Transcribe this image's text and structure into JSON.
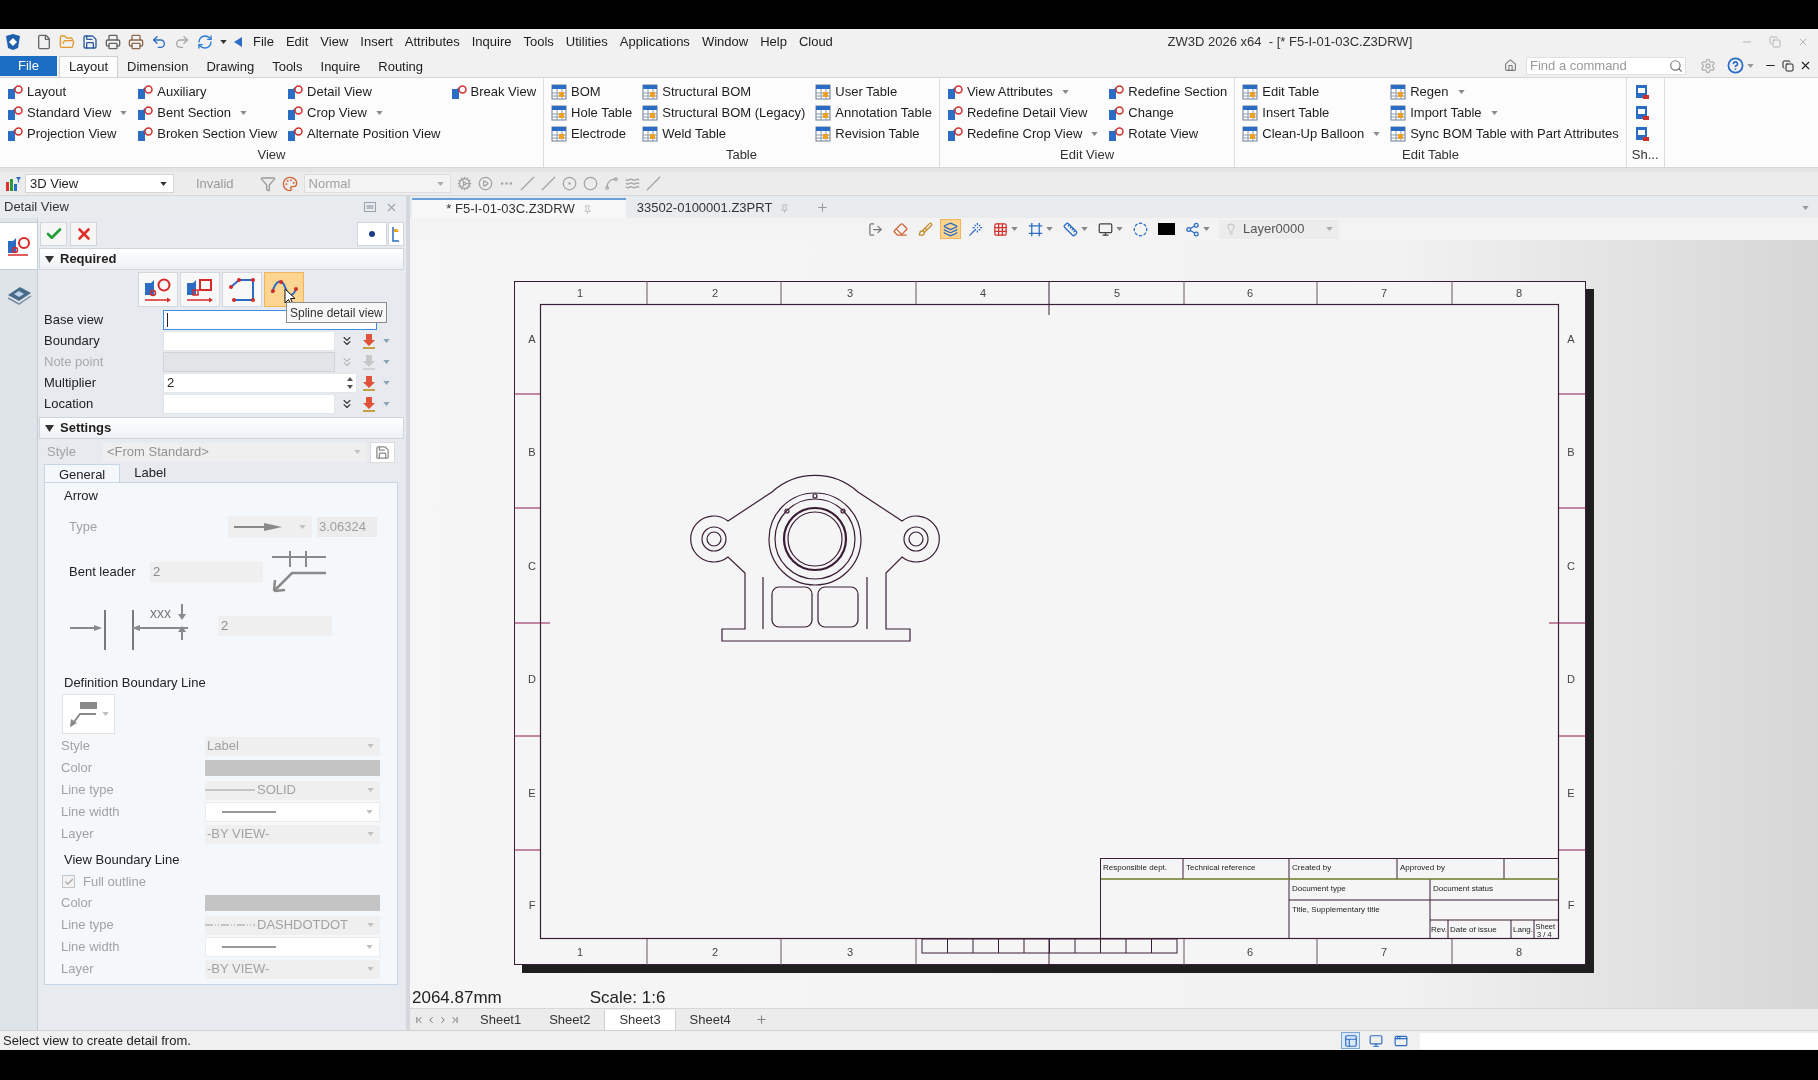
{
  "window": {
    "title": "ZW3D 2026 x64  - [* F5-I-01-03C.Z3DRW]"
  },
  "menu_bar": [
    "File",
    "Edit",
    "View",
    "Insert",
    "Attributes",
    "Inquire",
    "Tools",
    "Utilities",
    "Applications",
    "Window",
    "Help",
    "Cloud"
  ],
  "ribbon_tabs": [
    {
      "label": "File",
      "kind": "application",
      "selected": false
    },
    {
      "label": "Layout",
      "kind": "tab",
      "selected": true
    },
    {
      "label": "Dimension",
      "kind": "tab",
      "selected": false
    },
    {
      "label": "Drawing",
      "kind": "tab",
      "selected": false
    },
    {
      "label": "Tools",
      "kind": "tab",
      "selected": false
    },
    {
      "label": "Inquire",
      "kind": "tab",
      "selected": false
    },
    {
      "label": "Routing",
      "kind": "tab",
      "selected": false
    }
  ],
  "command_search": {
    "placeholder": "Find a command"
  },
  "ribbon_groups": [
    {
      "label": "View",
      "columns": [
        [
          {
            "label": "Layout",
            "dropdown": false
          },
          {
            "label": "Standard View",
            "dropdown": true
          },
          {
            "label": "Projection View",
            "dropdown": false
          }
        ],
        [
          {
            "label": "Auxiliary",
            "dropdown": false
          },
          {
            "label": "Bent Section",
            "dropdown": true
          },
          {
            "label": "Broken Section View",
            "dropdown": false
          }
        ],
        [
          {
            "label": "Detail View",
            "dropdown": false
          },
          {
            "label": "Crop View",
            "dropdown": true
          },
          {
            "label": "Alternate Position View",
            "dropdown": false
          }
        ],
        [
          {
            "label": "Break View",
            "dropdown": false
          }
        ]
      ]
    },
    {
      "label": "Table",
      "columns": [
        [
          {
            "label": "BOM",
            "dropdown": false
          },
          {
            "label": "Hole Table",
            "dropdown": false
          },
          {
            "label": "Electrode",
            "dropdown": false
          }
        ],
        [
          {
            "label": "Structural BOM",
            "dropdown": false
          },
          {
            "label": "Structural BOM (Legacy)",
            "dropdown": false
          },
          {
            "label": "Weld Table",
            "dropdown": false
          }
        ],
        [
          {
            "label": "User Table",
            "dropdown": false
          },
          {
            "label": "Annotation Table",
            "dropdown": false
          },
          {
            "label": "Revision Table",
            "dropdown": false
          }
        ]
      ]
    },
    {
      "label": "Edit View",
      "columns": [
        [
          {
            "label": "View Attributes",
            "dropdown": true
          },
          {
            "label": "Redefine Detail View",
            "dropdown": false
          },
          {
            "label": "Redefine Crop View",
            "dropdown": true
          }
        ],
        [
          {
            "label": "Redefine Section",
            "dropdown": false
          },
          {
            "label": "Change",
            "dropdown": false
          },
          {
            "label": "Rotate View",
            "dropdown": false
          }
        ]
      ]
    },
    {
      "label": "Edit Table",
      "columns": [
        [
          {
            "label": "Edit Table",
            "dropdown": false
          },
          {
            "label": "Insert Table",
            "dropdown": false
          },
          {
            "label": "Clean-Up Balloon",
            "dropdown": true
          }
        ],
        [
          {
            "label": "Regen",
            "dropdown": true
          },
          {
            "label": "Import Table",
            "dropdown": true
          },
          {
            "label": "Sync BOM Table with Part Attributes",
            "dropdown": false
          }
        ]
      ]
    },
    {
      "label": "Sh...",
      "columns": [
        [
          {
            "dropdown": false
          },
          {
            "dropdown": false
          },
          {
            "dropdown": false
          }
        ]
      ]
    }
  ],
  "view_toolbar": {
    "view": "3D View",
    "filter": {
      "label": "Invalid",
      "disabled": true
    },
    "mode": {
      "value": "Normal",
      "disabled": true
    }
  },
  "command_panel": {
    "title": "Detail View",
    "side_tabs": [
      {
        "selected": true
      },
      {
        "selected": false
      }
    ],
    "required": {
      "label": "Required",
      "expanded": true,
      "methods": [
        {
          "selected": false
        },
        {
          "selected": false
        },
        {
          "selected": false
        },
        {
          "selected": true
        }
      ],
      "tooltip": "Spline detail view",
      "fields": [
        {
          "label": "Base view",
          "kind": "entry",
          "focused": true,
          "disabled": false
        },
        {
          "label": "Boundary",
          "kind": "pick",
          "focused": false,
          "disabled": false
        },
        {
          "label": "Note point",
          "kind": "pick",
          "focused": false,
          "disabled": true
        },
        {
          "label": "Multiplier",
          "kind": "number",
          "value": "2",
          "focused": false,
          "disabled": false
        },
        {
          "label": "Location",
          "kind": "pick",
          "focused": false,
          "disabled": false
        }
      ]
    },
    "settings": {
      "label": "Settings",
      "expanded": true,
      "style": {
        "label": "Style",
        "value": "<From Standard>",
        "disabled": true
      },
      "tabs": [
        {
          "label": "General",
          "selected": true
        },
        {
          "label": "Label",
          "selected": false
        }
      ],
      "arrow": {
        "heading": "Arrow",
        "type": {
          "label": "Type",
          "value": "3.06324",
          "disabled": true
        },
        "bent_leader": {
          "label": "Bent leader",
          "value": "2"
        },
        "extension": {
          "sample": "xxx",
          "value": "2"
        }
      },
      "definition_boundary_line": {
        "heading": "Definition Boundary Line",
        "properties": [
          {
            "label": "Style",
            "kind": "select",
            "value": "Label",
            "disabled": true
          },
          {
            "label": "Color",
            "kind": "color",
            "disabled": true
          },
          {
            "label": "Line type",
            "kind": "line_type",
            "dashed": false,
            "value": "SOLID",
            "disabled": true
          },
          {
            "label": "Line width",
            "kind": "line_width",
            "disabled": true
          },
          {
            "label": "Layer",
            "kind": "select",
            "value": "-BY VIEW-",
            "disabled": true
          }
        ]
      },
      "view_boundary_line": {
        "heading": "View Boundary Line",
        "full_outline": {
          "label": "Full outline",
          "checked": true,
          "disabled": true
        },
        "properties": [
          {
            "label": "Color",
            "kind": "color",
            "disabled": true
          },
          {
            "label": "Line type",
            "kind": "line_type",
            "dashed": true,
            "value": "DASHDOTDOT",
            "disabled": true
          },
          {
            "label": "Line width",
            "kind": "line_width",
            "disabled": true
          },
          {
            "label": "Layer",
            "kind": "select",
            "value": "-BY VIEW-",
            "disabled": true
          }
        ]
      }
    }
  },
  "documents": [
    {
      "label": "* F5-I-01-03C.Z3DRW",
      "selected": true
    },
    {
      "label": "33502-0100001.Z3PRT",
      "selected": false
    }
  ],
  "drawing_toolbar": {
    "tools": [
      {
        "active": false,
        "dropdown": false
      },
      {
        "active": false,
        "dropdown": false
      },
      {
        "active": false,
        "dropdown": false
      },
      {
        "active": true,
        "dropdown": false
      },
      {
        "active": false,
        "dropdown": false
      },
      {
        "active": false,
        "dropdown": true
      },
      {
        "active": false,
        "dropdown": true
      },
      {
        "active": false,
        "dropdown": true
      },
      {
        "active": false,
        "dropdown": true
      },
      {
        "active": false,
        "dropdown": false
      },
      {
        "active": false,
        "dropdown": false
      },
      {
        "active": false,
        "dropdown": true
      }
    ],
    "layer": "Layer0000"
  },
  "sheet": {
    "top_zone_labels": [
      "1",
      "2",
      "3",
      "4",
      "5",
      "6",
      "7",
      "8"
    ],
    "bottom_zone_labels": [
      "1",
      "2",
      "3",
      "6",
      "7",
      "8"
    ],
    "left_zone_labels": [
      "A",
      "B",
      "C",
      "D",
      "E",
      "F"
    ],
    "right_zone_labels": [
      "A",
      "B",
      "C",
      "D",
      "E",
      "F"
    ],
    "title_block": [
      "Responsible dept.",
      "Technical reference",
      "Created by",
      "Approved by",
      "Document type",
      "Document status",
      "Title, Supplementary title",
      "Rev.",
      "Date of issue",
      "Lang.",
      "Sheet",
      "3 / 4"
    ]
  },
  "readouts": {
    "length": "2064.87mm",
    "scale": "Scale: 1:6"
  },
  "sheets": [
    {
      "label": "Sheet1",
      "selected": false
    },
    {
      "label": "Sheet2",
      "selected": false
    },
    {
      "label": "Sheet3",
      "selected": true
    },
    {
      "label": "Sheet4",
      "selected": false
    }
  ],
  "status_bar": {
    "message": "Select view to create detail from.",
    "layouts": [
      {
        "selected": true
      },
      {
        "selected": false
      },
      {
        "selected": false
      }
    ]
  }
}
